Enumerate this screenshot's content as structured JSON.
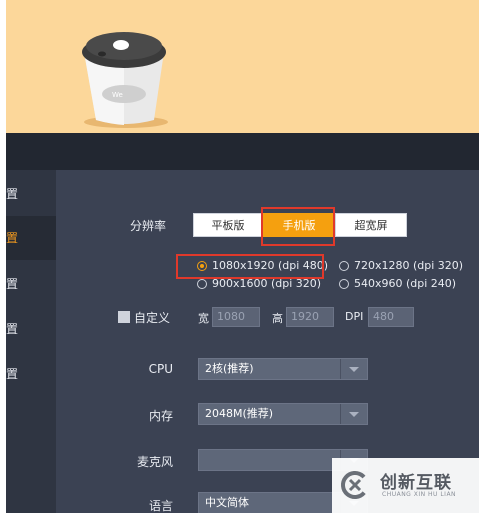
{
  "sidebar": {
    "items": [
      {
        "label": "设置",
        "active": false
      },
      {
        "label": "设置",
        "active": true
      },
      {
        "label": "设置",
        "active": false
      },
      {
        "label": "设置",
        "active": false
      },
      {
        "label": "设置",
        "active": false
      }
    ]
  },
  "resolution": {
    "label": "分辨率",
    "modes": [
      "平板版",
      "手机版",
      "超宽屏"
    ],
    "selected_mode": "手机版",
    "options": [
      "1080x1920 (dpi 480)",
      "720x1280 (dpi 320)",
      "900x1600 (dpi 320)",
      "540x960 (dpi 240)"
    ],
    "selected_option": "1080x1920 (dpi 480)"
  },
  "custom": {
    "label": "自定义",
    "width_label": "宽",
    "width_value": "1080",
    "height_label": "高",
    "height_value": "1920",
    "dpi_label": "DPI",
    "dpi_value": "480"
  },
  "cpu": {
    "label": "CPU",
    "value": "2核(推荐)"
  },
  "memory": {
    "label": "内存",
    "value": "2048M(推荐)"
  },
  "microphone": {
    "label": "麦克风",
    "value": ""
  },
  "language": {
    "label": "语言",
    "value": "中文简体"
  },
  "watermark": {
    "title": "创新互联",
    "subtitle": "CHUANG XIN HU LIAN"
  },
  "colors": {
    "accent": "#f5a00f",
    "highlight_box": "#e0392b",
    "banner": "#fcd79a",
    "panel": "#3b4253"
  },
  "icons": [
    "coffee-cup-illustration",
    "radio-icon",
    "checkbox-icon",
    "chevron-down-icon",
    "brand-logo-icon"
  ]
}
